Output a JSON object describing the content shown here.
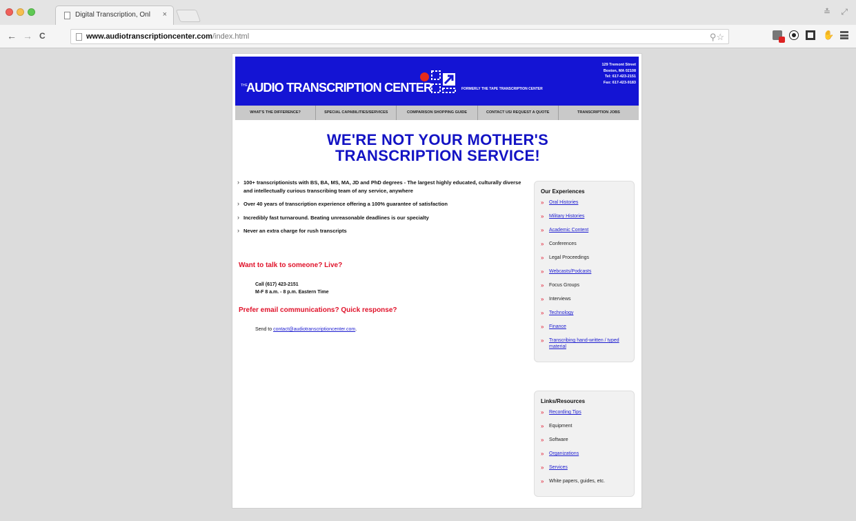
{
  "browser": {
    "tab_title": "Digital Transcription, Onl",
    "tab_close": "×",
    "url_host": "www.audiotranscriptioncenter.com",
    "url_path": "/index.html",
    "back": "←",
    "forward": "→",
    "reload": "C",
    "window_controls": "≛ ⤢",
    "omnibox_icons": "⚲☆"
  },
  "site": {
    "logo_the": "THE",
    "logo_text": "AUDIO TRANSCRIPTION CENTER",
    "logo_tagline": "FORMERLY THE TAPE TRANSCRIPTION CENTER",
    "address": [
      "129 Tremont Street",
      "Boston, MA 02108",
      "Tel: 617-423-2151",
      "Fax: 617-423-9183"
    ],
    "nav": [
      "WHAT'S THE DIFFERENCE?",
      "SPECIAL CAPABILITIES/SERVICES",
      "COMPARISON SHOPPING GUIDE",
      "CONTACT US/ REQUEST A QUOTE",
      "TRANSCRIPTION JOBS"
    ],
    "headline_1": "WE'RE NOT YOUR MOTHER'S",
    "headline_2": "TRANSCRIPTION SERVICE!",
    "features": [
      "100+ transcriptionists with BS, BA, MS, MA, JD and PhD degrees - The largest highly educated, culturally diverse and intellectually curious transcribing team of any service, anywhere",
      "Over 40 years of transcription experience offering a 100% guarantee of satisfaction",
      "Incredibly fast turnaround. Beating unreasonable deadlines is our specialty",
      "Never an extra charge for rush transcripts"
    ],
    "talk_heading": "Want to talk to someone? Live?",
    "call_line": "Call (617) 423-2151",
    "hours_line": "M-F 8 a.m. - 8 p.m. Eastern Time",
    "email_heading": "Prefer email communications? Quick response?",
    "send_prefix": "Send to ",
    "email": "contact@audiotranscriptioncenter.com",
    "send_suffix": ".",
    "experiences_title": "Our Experiences",
    "experiences": [
      {
        "label": "Oral Histories",
        "link": true
      },
      {
        "label": "Military Histories",
        "link": true
      },
      {
        "label": "Academic Content",
        "link": true
      },
      {
        "label": "Conferences",
        "link": false
      },
      {
        "label": "Legal Proceedings",
        "link": false
      },
      {
        "label": "Webcasts/Podcasts",
        "link": true
      },
      {
        "label": "Focus Groups",
        "link": false
      },
      {
        "label": "Interviews",
        "link": false
      },
      {
        "label": "Technology",
        "link": true
      },
      {
        "label": "Finance",
        "link": true
      },
      {
        "label": "Transcribing hand-written / typed material",
        "link": true
      }
    ],
    "resources_title": "Links/Resources",
    "resources": [
      {
        "label": "Recording Tips",
        "link": true
      },
      {
        "label": "Equipment",
        "link": false
      },
      {
        "label": "Software",
        "link": false
      },
      {
        "label": "Organizations",
        "link": true
      },
      {
        "label": "Services",
        "link": true
      },
      {
        "label": "White papers, guides, etc.",
        "link": false
      }
    ]
  },
  "colors": {
    "banner_blue": "#1414d4",
    "headline_blue": "#1313c4",
    "accent_red": "#e0122a",
    "link_blue": "#1b1bd0"
  }
}
